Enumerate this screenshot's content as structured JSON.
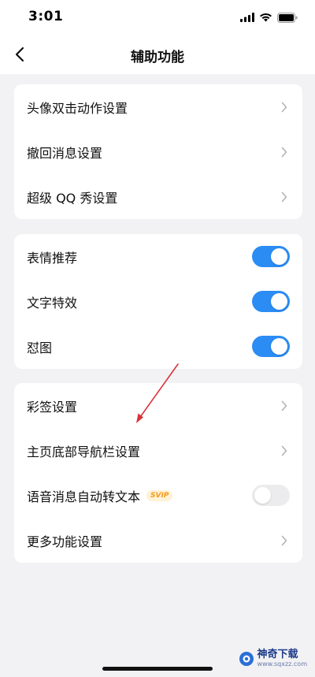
{
  "status_bar": {
    "time": "3:01"
  },
  "nav": {
    "title": "辅助功能"
  },
  "group1": [
    {
      "label": "头像双击动作设置"
    },
    {
      "label": "撤回消息设置"
    },
    {
      "label": "超级 QQ 秀设置"
    }
  ],
  "group2": [
    {
      "label": "表情推荐",
      "toggle": "on"
    },
    {
      "label": "文字特效",
      "toggle": "on"
    },
    {
      "label": "怼图",
      "toggle": "on"
    }
  ],
  "group3": [
    {
      "label": "彩签设置"
    },
    {
      "label": "主页底部导航栏设置"
    },
    {
      "label": "语音消息自动转文本",
      "badge": "SVIP",
      "toggle": "off"
    },
    {
      "label": "更多功能设置"
    }
  ],
  "watermark": {
    "title": "神奇下载",
    "url": "www.sqxzz.com"
  },
  "colors": {
    "toggle_on": "#2b8cf4",
    "toggle_off": "#ececee",
    "annotation_arrow": "#d9343a",
    "badge": "#f59a1a"
  }
}
